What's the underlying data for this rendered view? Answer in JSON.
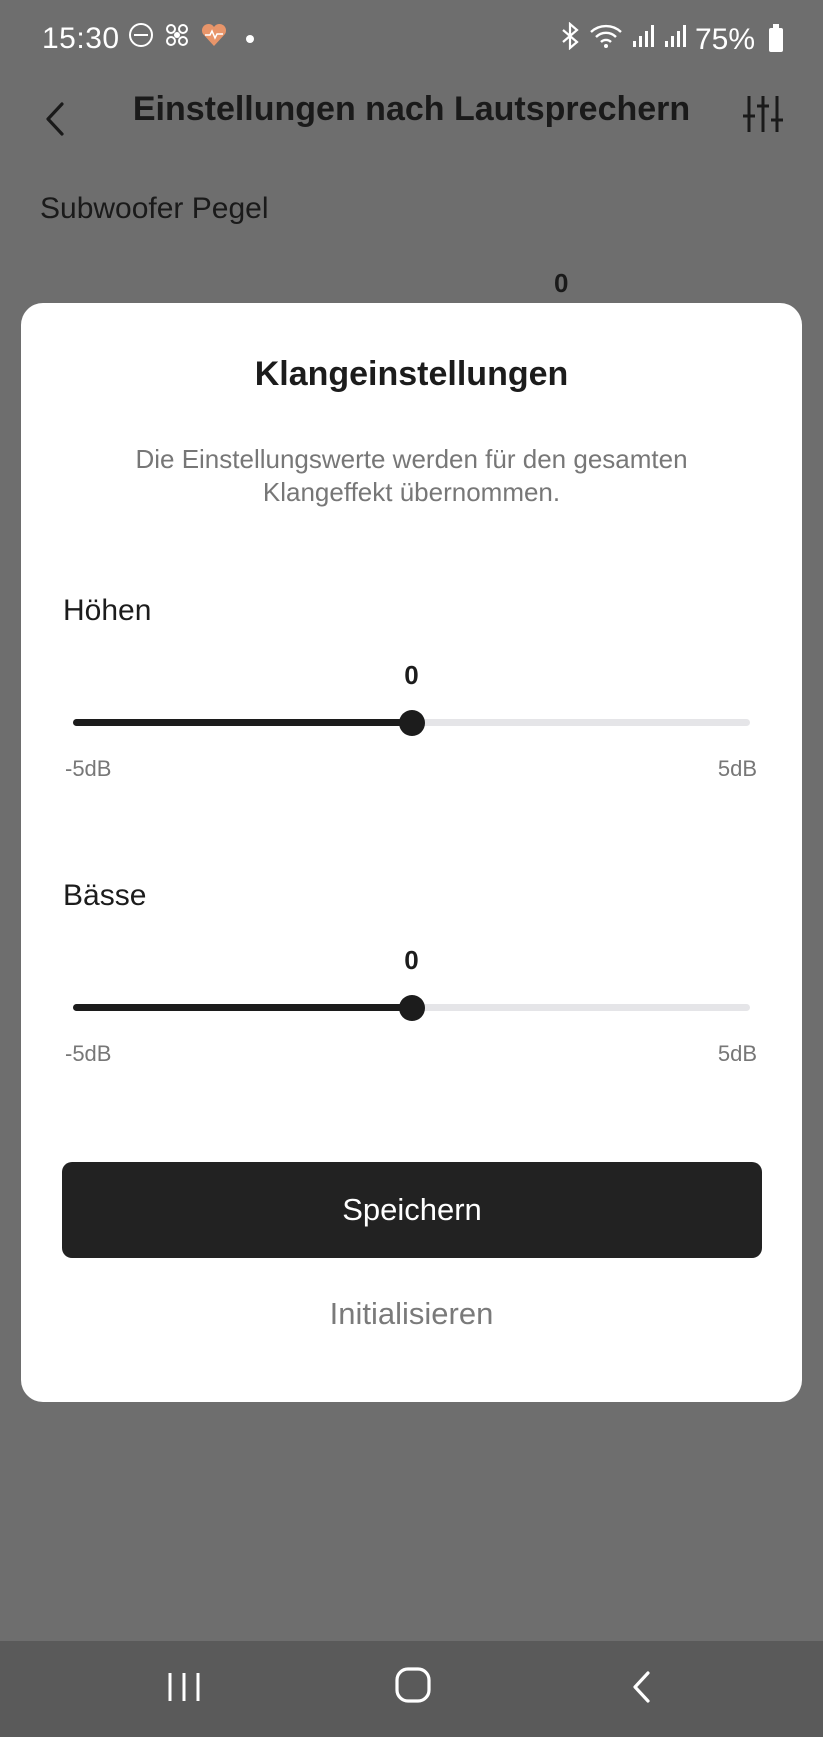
{
  "status_bar": {
    "time": "15:30",
    "battery_text": "75%",
    "left_icons": [
      "app-notification-icon",
      "fan-icon",
      "heart-rate-icon"
    ],
    "right_icons": [
      "bluetooth-icon",
      "wifi-icon",
      "signal-icon",
      "signal-icon",
      "battery-icon"
    ]
  },
  "header": {
    "title": "Einstellungen nach Lautsprechern",
    "back_icon": "chevron-left-icon",
    "action_icon": "equalizer-icon"
  },
  "background": {
    "section_label": "Subwoofer Pegel",
    "value": "0"
  },
  "dialog": {
    "title": "Klangeinstellungen",
    "description_line1": "Die Einstellungswerte werden für den gesamten",
    "description_line2": "Klangeffekt übernommen.",
    "sliders": [
      {
        "label": "Höhen",
        "value": "0",
        "min_label": "-5dB",
        "max_label": "5dB",
        "fraction": 0.5
      },
      {
        "label": "Bässe",
        "value": "0",
        "min_label": "-5dB",
        "max_label": "5dB",
        "fraction": 0.5
      }
    ],
    "save_label": "Speichern",
    "reset_label": "Initialisieren"
  },
  "nav": {
    "icons": [
      "recents-icon",
      "home-icon",
      "back-icon"
    ]
  },
  "colors": {
    "overlay_bg": "#6e6e6e",
    "dialog_bg": "#ffffff",
    "primary": "#222222",
    "track": "#e5e5e8",
    "muted_text": "#777777",
    "heart_accent": "#e8956a"
  }
}
